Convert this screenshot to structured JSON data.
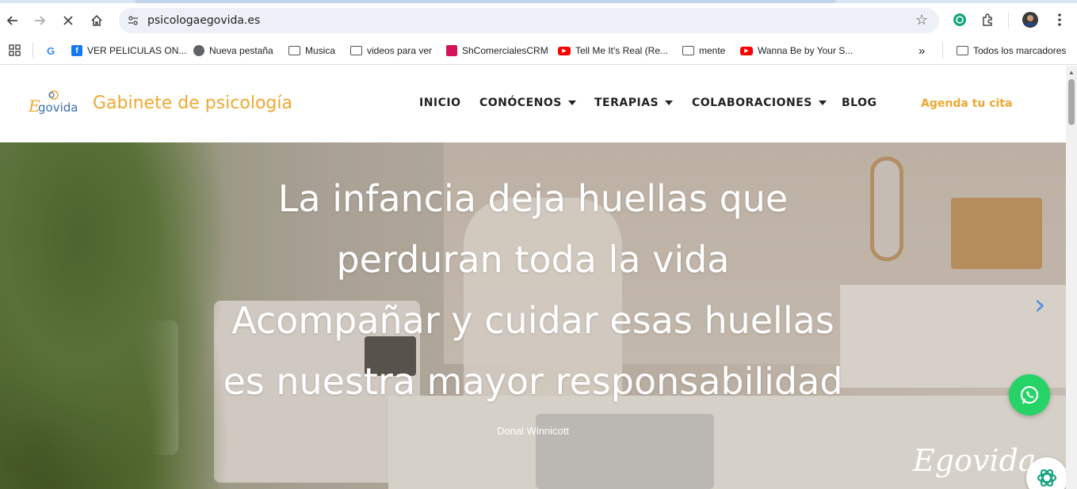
{
  "browser": {
    "url": "psicologaegovida.es",
    "bookmarks": [
      {
        "label": "VER PELICULAS ON...",
        "icon": "facebook-icon"
      },
      {
        "label": "Nueva pestaña",
        "icon": "globe-icon"
      },
      {
        "label": "Musica",
        "icon": "folder-icon"
      },
      {
        "label": "videos para ver",
        "icon": "folder-icon"
      },
      {
        "label": "ShComercialesCRM",
        "icon": "app-icon"
      },
      {
        "label": "Tell Me It's Real (Re...",
        "icon": "youtube-icon"
      },
      {
        "label": "mente",
        "icon": "folder-icon"
      },
      {
        "label": "Wanna Be by Your S...",
        "icon": "youtube-icon"
      }
    ],
    "all_bookmarks": "Todos los marcadores",
    "overflow": "»"
  },
  "site": {
    "brand": "Gabinete de psicología",
    "nav": [
      {
        "label": "INICIO",
        "dropdown": false
      },
      {
        "label": "CONÓCENOS",
        "dropdown": true
      },
      {
        "label": "TERAPIAS",
        "dropdown": true
      },
      {
        "label": "COLABORACIONES",
        "dropdown": true
      },
      {
        "label": "BLOG",
        "dropdown": false
      }
    ],
    "cta": "Agenda tu cita",
    "accent_color": "#f0a830"
  },
  "hero": {
    "quote_lines": [
      "La infancia deja huellas que",
      "perduran toda la vida",
      "Acompañar y cuidar esas huellas",
      "es nuestra mayor responsabilidad"
    ],
    "author": "Donal Winnicott",
    "next_arrow": "›",
    "watermark": "Egovida"
  },
  "colors": {
    "whatsapp": "#25d366",
    "slider_arrow": "#4a8fe0"
  }
}
